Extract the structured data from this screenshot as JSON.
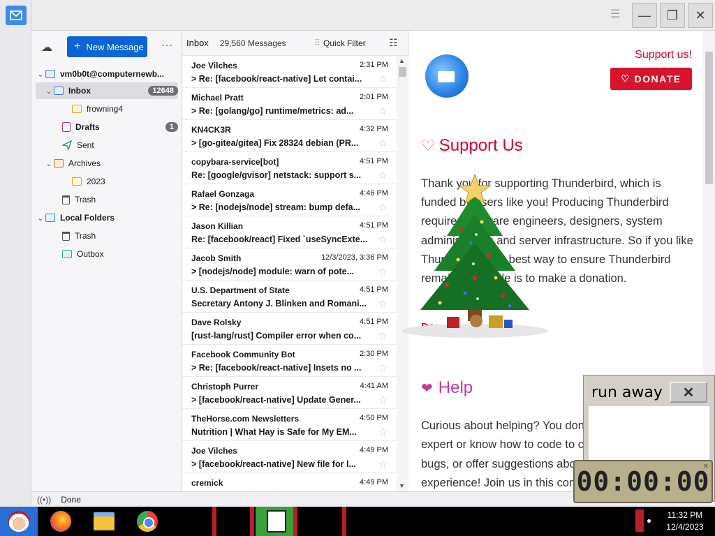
{
  "window": {
    "minimize_icon": "minimize-icon",
    "restore_icon": "restore-icon",
    "close_icon": "close-icon",
    "menu_icon": "hamburger-icon"
  },
  "folder_pane": {
    "new_message_label": "New Message",
    "more_label": "···",
    "account": "vm0b0t@computernewb...",
    "folders": [
      {
        "label": "Inbox",
        "badge": "12648"
      },
      {
        "label": "frowning4"
      },
      {
        "label": "Drafts",
        "badge": "1"
      },
      {
        "label": "Sent"
      },
      {
        "label": "Archives"
      },
      {
        "label": "2023"
      },
      {
        "label": "Trash"
      },
      {
        "label": "Local Folders"
      },
      {
        "label": "Trash"
      },
      {
        "label": "Outbox"
      }
    ]
  },
  "message_list": {
    "folder_name": "Inbox",
    "message_count": "29,560 Messages",
    "quick_filter_label": "Quick Filter",
    "messages": [
      {
        "sender": "Joe Vilches",
        "date": "2:31 PM",
        "subject": "Re: [facebook/react-native] Let contai...",
        "thread": true
      },
      {
        "sender": "Michael Pratt",
        "date": "2:01 PM",
        "subject": "Re: [golang/go] runtime/metrics: ad...",
        "thread": true
      },
      {
        "sender": "KN4CK3R",
        "date": "4:32 PM",
        "subject": "[go-gitea/gitea] Fix 28324 debian (PR...",
        "thread": true
      },
      {
        "sender": "copybara-service[bot]",
        "date": "4:51 PM",
        "subject": "Re: [google/gvisor] netstack: support s...",
        "thread": false
      },
      {
        "sender": "Rafael Gonzaga",
        "date": "4:46 PM",
        "subject": "Re: [nodejs/node] stream: bump defa...",
        "thread": true
      },
      {
        "sender": "Jason Killian",
        "date": "4:51 PM",
        "subject": "Re: [facebook/react] Fixed `useSyncExte...",
        "thread": false
      },
      {
        "sender": "Jacob Smith",
        "date": "12/3/2023, 3:36 PM",
        "subject": "[nodejs/node] module: warn of pote...",
        "thread": true
      },
      {
        "sender": "U.S. Department of State",
        "date": "4:51 PM",
        "subject": "Secretary Antony J. Blinken and Romani...",
        "thread": false
      },
      {
        "sender": "Dave Rolsky",
        "date": "4:51 PM",
        "subject": "[rust-lang/rust] Compiler error when co...",
        "thread": false
      },
      {
        "sender": "Facebook Community Bot",
        "date": "2:30 PM",
        "subject": "Re: [facebook/react-native] Insets no ...",
        "thread": true
      },
      {
        "sender": "Christoph Purrer",
        "date": "4:41 AM",
        "subject": "[facebook/react-native] Update Gener...",
        "thread": true
      },
      {
        "sender": "TheHorse.com Newsletters",
        "date": "4:50 PM",
        "subject": "Nutrition | What Hay is Safe for My EM...",
        "thread": false
      },
      {
        "sender": "Joe Vilches",
        "date": "4:49 PM",
        "subject": "[facebook/react-native] New file for l...",
        "thread": true
      },
      {
        "sender": "cremick",
        "date": "4:49 PM",
        "subject": "",
        "thread": false
      }
    ]
  },
  "content": {
    "support_link": "Support us!",
    "donate_button": "DONATE",
    "support_heading": "Support Us",
    "support_text": "Thank you for supporting Thunderbird, which is funded by users like you! Producing Thunderbird requires software engineers, designers, system administrators and server infrastructure. So if you like Thunderbird, the best way to ensure Thunderbird remains available is to make a donation.",
    "donate_link": "Donate",
    "help_heading": "Help",
    "help_text": "Curious about helping? You don't have to be an expert or know how to code to contribute. Test, report bugs, or offer suggestions about how to improve the experience! Join us in this community."
  },
  "status": {
    "text": "Done"
  },
  "run_away": {
    "title": "run away",
    "close_label": "✕"
  },
  "timer": {
    "value": "00:00:00"
  },
  "taskbar": {
    "time": "11:32 PM",
    "date": "12/4/2023"
  },
  "colors": {
    "accent": "#0a64d8",
    "brand_red": "#d6002f",
    "help_magenta": "#c43b9c"
  }
}
